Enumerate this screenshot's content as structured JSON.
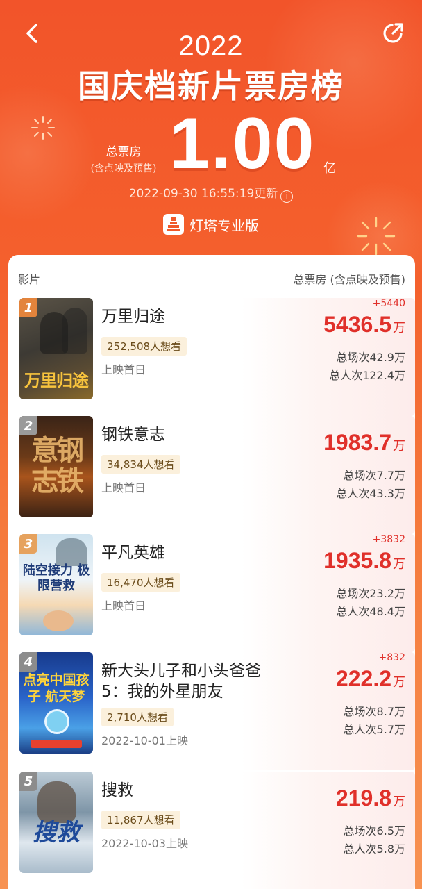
{
  "header": {
    "year": "2022",
    "title": "国庆档新片票房榜",
    "total_label": "总票房",
    "total_sub": "(含点映及预售)",
    "total_value": "1.00",
    "total_unit": "亿",
    "update_time": "2022-09-30 16:55:19更新",
    "brand": "灯塔专业版"
  },
  "icons": {
    "back": "back-chevron-icon",
    "share": "share-icon",
    "info": "info-icon",
    "brand_logo": "dengta-logo"
  },
  "columns": {
    "left": "影片",
    "right": "总票房 (含点映及预售)"
  },
  "colors": {
    "accent_red": "#e0302a",
    "header_orange": "#f2542a",
    "badge_bg": "#fbf0dc"
  },
  "movies": [
    {
      "rank": "1",
      "rank_color": "#e3843c",
      "name": "万里归途",
      "want": "252,508人想看",
      "release": "上映首日",
      "delta": "+5440",
      "box": "5436.5",
      "box_unit": "万",
      "sessions": "总场次42.9万",
      "viewers": "总人次122.4万",
      "poster_text": "万里归途"
    },
    {
      "rank": "2",
      "rank_color": "#9a9a9a",
      "name": "钢铁意志",
      "want": "34,834人想看",
      "release": "上映首日",
      "delta": "",
      "box": "1983.7",
      "box_unit": "万",
      "sessions": "总场次7.7万",
      "viewers": "总人次43.3万",
      "poster_text": "意钢志铁"
    },
    {
      "rank": "3",
      "rank_color": "#e6a25e",
      "name": "平凡英雄",
      "want": "16,470人想看",
      "release": "上映首日",
      "delta": "+3832",
      "box": "1935.8",
      "box_unit": "万",
      "sessions": "总场次23.2万",
      "viewers": "总人次48.4万",
      "poster_text": "陆空接力 极限营救"
    },
    {
      "rank": "4",
      "rank_color": "#8c8c8c",
      "name": "新大头儿子和小头爸爸5：我的外星朋友",
      "want": "2,710人想看",
      "release": "2022-10-01上映",
      "delta": "+832",
      "box": "222.2",
      "box_unit": "万",
      "sessions": "总场次8.7万",
      "viewers": "总人次5.7万",
      "poster_text": "点亮中国孩子 航天梦"
    },
    {
      "rank": "5",
      "rank_color": "#8c8c8c",
      "name": "搜救",
      "want": "11,867人想看",
      "release": "2022-10-03上映",
      "delta": "",
      "box": "219.8",
      "box_unit": "万",
      "sessions": "总场次6.5万",
      "viewers": "总人次5.8万",
      "poster_text": "搜救"
    }
  ]
}
